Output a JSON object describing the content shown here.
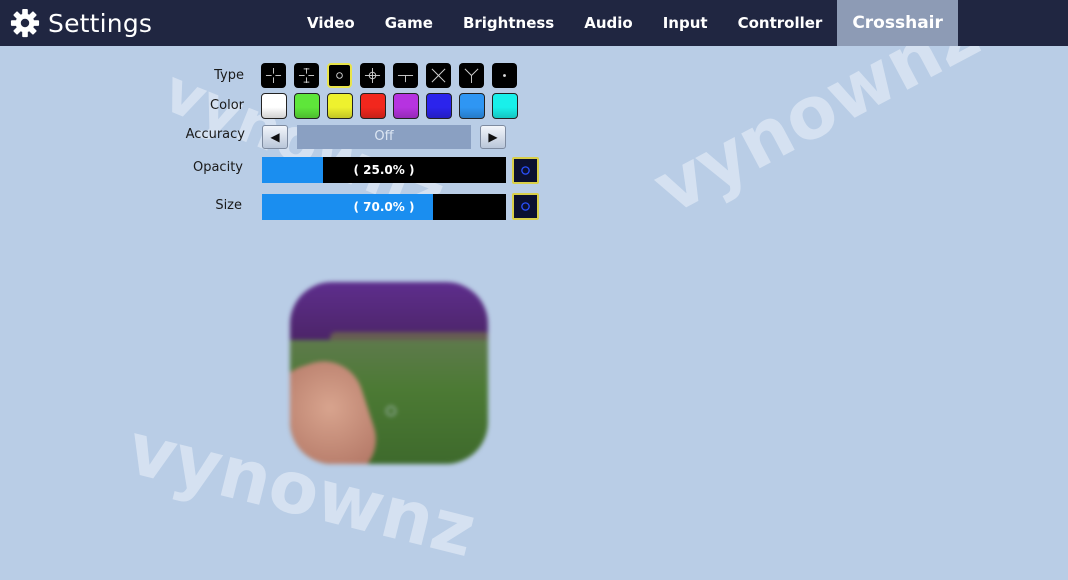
{
  "app": {
    "title": "Settings"
  },
  "tabs": [
    {
      "label": "Video"
    },
    {
      "label": "Game"
    },
    {
      "label": "Brightness"
    },
    {
      "label": "Audio"
    },
    {
      "label": "Input"
    },
    {
      "label": "Controller"
    },
    {
      "label": "Crosshair",
      "active": true
    }
  ],
  "crosshair": {
    "type_label": "Type",
    "types": [
      "plus-gap",
      "plus-ticks",
      "circle",
      "plus-circle",
      "plus-split",
      "x",
      "y",
      "dot"
    ],
    "selected_type": "circle",
    "color_label": "Color",
    "colors": [
      "#ffffff",
      "#5ee63a",
      "#eef12e",
      "#f2271d",
      "#b633e0",
      "#2b24ec",
      "#2f96f3",
      "#19f0ea"
    ],
    "accuracy_label": "Accuracy",
    "accuracy_value": "Off",
    "opacity_label": "Opacity",
    "opacity_value": "( 25.0% )",
    "opacity_fraction": 0.25,
    "size_label": "Size",
    "size_value": "( 70.0% )",
    "size_fraction": 0.7
  },
  "watermark": {
    "text": "vynownz"
  }
}
